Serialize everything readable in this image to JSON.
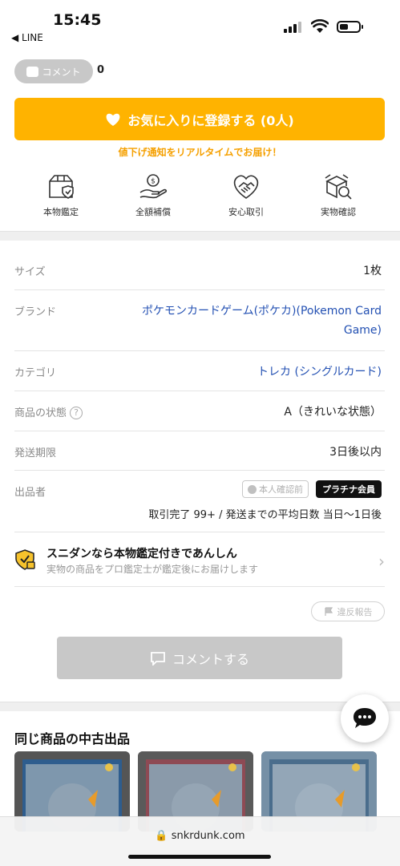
{
  "status": {
    "time": "15:45",
    "back_label": "◀ LINE"
  },
  "comment_pill": {
    "label": "コメント",
    "count": "0"
  },
  "favorite": {
    "label": "お気に入りに登録する (0人)",
    "note": "値下げ通知をリアルタイムでお届け！"
  },
  "features": [
    {
      "label": "本物鑑定",
      "icon": "authentic-box-icon"
    },
    {
      "label": "全額補償",
      "icon": "money-hand-icon"
    },
    {
      "label": "安心取引",
      "icon": "handshake-heart-icon"
    },
    {
      "label": "実物確認",
      "icon": "box-magnifier-icon"
    }
  ],
  "details": {
    "size": {
      "label": "サイズ",
      "value": "1枚"
    },
    "brand": {
      "label": "ブランド",
      "value_line1": "ポケモンカードゲーム(ポケカ)(Pokemon Card",
      "value_line2": "Game)"
    },
    "category": {
      "label": "カテゴリ",
      "value": "トレカ (シングルカード)"
    },
    "condition": {
      "label": "商品の状態",
      "value": "A（きれいな状態）"
    },
    "shipping": {
      "label": "発送期限",
      "value": "3日後以内"
    },
    "seller": {
      "label": "出品者",
      "verify_badge": "本人確認前",
      "tier_badge": "プラチナ会員",
      "stats": "取引完了 99+ / 発送までの平均日数 当日〜1日後"
    }
  },
  "assurance": {
    "title": "スニダンなら本物鑑定付きであんしん",
    "subtitle": "実物の商品をプロ鑑定士が鑑定後にお届けします"
  },
  "report_button": "違反報告",
  "comment_button": "コメントする",
  "similar": {
    "title": "同じ商品の中古出品"
  },
  "url_bar": {
    "domain": "snkrdunk.com"
  },
  "colors": {
    "accent": "#ffb300",
    "link": "#2451b3"
  }
}
